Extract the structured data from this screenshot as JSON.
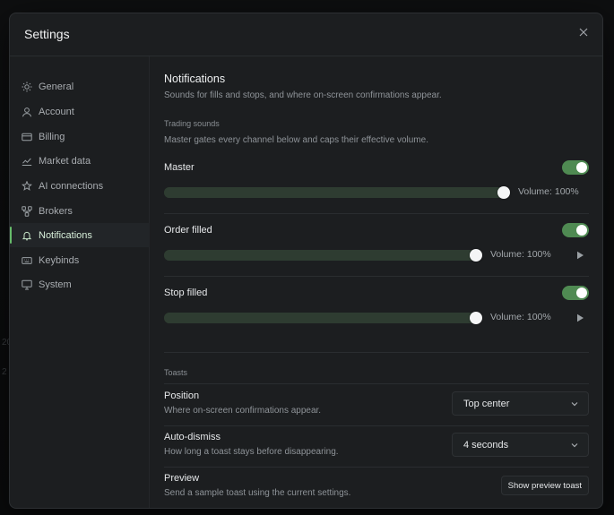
{
  "background": {
    "fragments": [
      "20",
      "2"
    ]
  },
  "modal": {
    "title": "Settings",
    "close_icon": "close-icon"
  },
  "sidebar": {
    "items": [
      {
        "label": "General",
        "icon": "sun-icon",
        "active": false
      },
      {
        "label": "Account",
        "icon": "user-icon",
        "active": false
      },
      {
        "label": "Billing",
        "icon": "credit-card-icon",
        "active": false
      },
      {
        "label": "Market data",
        "icon": "line-chart-icon",
        "active": false
      },
      {
        "label": "AI connections",
        "icon": "sparkles-icon",
        "active": false
      },
      {
        "label": "Brokers",
        "icon": "network-icon",
        "active": false
      },
      {
        "label": "Notifications",
        "icon": "bell-icon",
        "active": true
      },
      {
        "label": "Keybinds",
        "icon": "keyboard-icon",
        "active": false
      },
      {
        "label": "System",
        "icon": "monitor-icon",
        "active": false
      }
    ]
  },
  "notifications": {
    "title": "Notifications",
    "description": "Sounds for fills and stops, and where on-screen confirmations appear.",
    "trading_sounds": {
      "heading": "Trading sounds",
      "description": "Master gates every channel below and caps their effective volume.",
      "channels": [
        {
          "label": "Master",
          "enabled": true,
          "volume": 100,
          "volume_label": "Volume: 100%",
          "has_preview": false
        },
        {
          "label": "Order filled",
          "enabled": true,
          "volume": 100,
          "volume_label": "Volume: 100%",
          "has_preview": true
        },
        {
          "label": "Stop filled",
          "enabled": true,
          "volume": 100,
          "volume_label": "Volume: 100%",
          "has_preview": true
        }
      ]
    },
    "toasts": {
      "heading": "Toasts",
      "position": {
        "label": "Position",
        "description": "Where on-screen confirmations appear.",
        "value": "Top center"
      },
      "auto_dismiss": {
        "label": "Auto-dismiss",
        "description": "How long a toast stays before disappearing.",
        "value": "4 seconds"
      },
      "preview": {
        "label": "Preview",
        "description": "Send a sample toast using the current settings.",
        "button_label": "Show preview toast"
      }
    }
  },
  "colors": {
    "accent": "#66bb6a",
    "toggle_on": "#4f8a52",
    "modal_bg": "#1c1e20"
  }
}
